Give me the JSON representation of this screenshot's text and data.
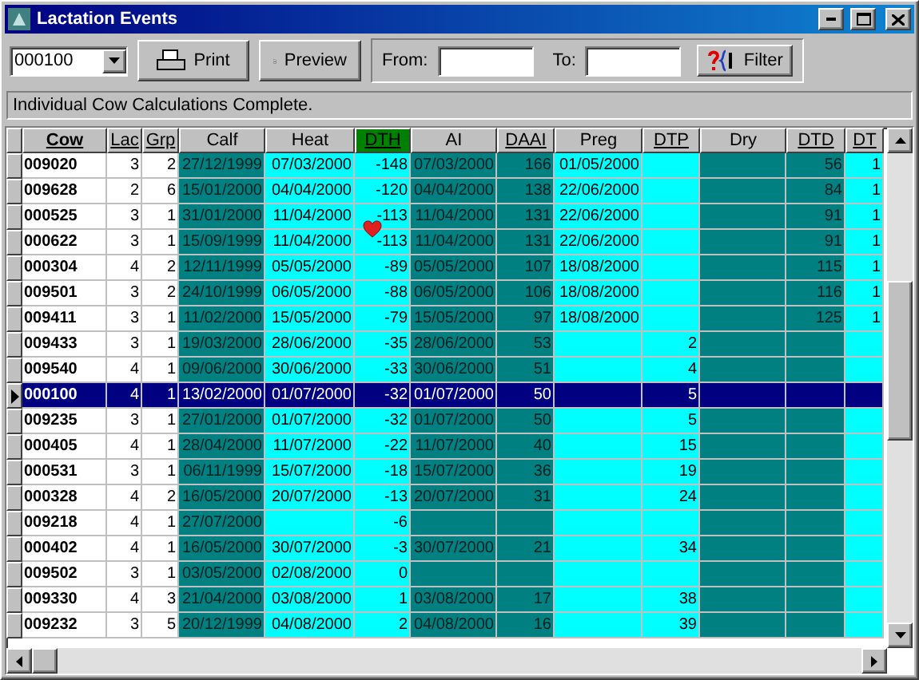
{
  "window": {
    "title": "Lactation Events"
  },
  "toolbar": {
    "cow_select": "000100",
    "print": "Print",
    "preview": "Preview",
    "from_label": "From:",
    "to_label": "To:",
    "filter": "Filter"
  },
  "status": "Individual Cow Calculations Complete.",
  "table": {
    "columns": [
      {
        "label": "Cow",
        "underlined": true,
        "color": "#ffffff",
        "highlighted": false
      },
      {
        "label": "Lac",
        "underlined": true,
        "color": "#ffffff",
        "highlighted": false
      },
      {
        "label": "Grp",
        "underlined": true,
        "color": "#ffffff",
        "highlighted": false
      },
      {
        "label": "Calf",
        "underlined": false,
        "color": "#008080",
        "highlighted": false
      },
      {
        "label": "Heat",
        "underlined": false,
        "color": "#00ffff",
        "highlighted": false
      },
      {
        "label": "DTH",
        "underlined": true,
        "color": "#00ffff",
        "highlighted": true
      },
      {
        "label": "AI",
        "underlined": false,
        "color": "#008080",
        "highlighted": false
      },
      {
        "label": "DAAI",
        "underlined": true,
        "color": "#008080",
        "highlighted": false
      },
      {
        "label": "Preg",
        "underlined": false,
        "color": "#00ffff",
        "highlighted": false
      },
      {
        "label": "DTP",
        "underlined": true,
        "color": "#00ffff",
        "highlighted": false
      },
      {
        "label": "Dry",
        "underlined": false,
        "color": "#008080",
        "highlighted": false
      },
      {
        "label": "DTD",
        "underlined": true,
        "color": "#008080",
        "highlighted": false
      },
      {
        "label": "DT",
        "underlined": true,
        "color": "#00ffff",
        "highlighted": false
      }
    ],
    "rows": [
      {
        "selected": false,
        "cells": [
          "009020",
          "3",
          "2",
          "27/12/1999",
          "07/03/2000",
          "-148",
          "07/03/2000",
          "166",
          "01/05/2000",
          "",
          "",
          "56",
          "1"
        ]
      },
      {
        "selected": false,
        "cells": [
          "009628",
          "2",
          "6",
          "15/01/2000",
          "04/04/2000",
          "-120",
          "04/04/2000",
          "138",
          "22/06/2000",
          "",
          "",
          "84",
          "1"
        ]
      },
      {
        "selected": false,
        "cells": [
          "000525",
          "3",
          "1",
          "31/01/2000",
          "11/04/2000",
          "-113",
          "11/04/2000",
          "131",
          "22/06/2000",
          "",
          "",
          "91",
          "1"
        ]
      },
      {
        "selected": false,
        "cells": [
          "000622",
          "3",
          "1",
          "15/09/1999",
          "11/04/2000",
          "-113",
          "11/04/2000",
          "131",
          "22/06/2000",
          "",
          "",
          "91",
          "1"
        ]
      },
      {
        "selected": false,
        "cells": [
          "000304",
          "4",
          "2",
          "12/11/1999",
          "05/05/2000",
          "-89",
          "05/05/2000",
          "107",
          "18/08/2000",
          "",
          "",
          "115",
          "1"
        ]
      },
      {
        "selected": false,
        "cells": [
          "009501",
          "3",
          "2",
          "24/10/1999",
          "06/05/2000",
          "-88",
          "06/05/2000",
          "106",
          "18/08/2000",
          "",
          "",
          "116",
          "1"
        ]
      },
      {
        "selected": false,
        "cells": [
          "009411",
          "3",
          "1",
          "11/02/2000",
          "15/05/2000",
          "-79",
          "15/05/2000",
          "97",
          "18/08/2000",
          "",
          "",
          "125",
          "1"
        ]
      },
      {
        "selected": false,
        "cells": [
          "009433",
          "3",
          "1",
          "19/03/2000",
          "28/06/2000",
          "-35",
          "28/06/2000",
          "53",
          "",
          "2",
          "",
          "",
          ""
        ]
      },
      {
        "selected": false,
        "cells": [
          "009540",
          "4",
          "1",
          "09/06/2000",
          "30/06/2000",
          "-33",
          "30/06/2000",
          "51",
          "",
          "4",
          "",
          "",
          ""
        ]
      },
      {
        "selected": true,
        "cells": [
          "000100",
          "4",
          "1",
          "13/02/2000",
          "01/07/2000",
          "-32",
          "01/07/2000",
          "50",
          "",
          "5",
          "",
          "",
          ""
        ]
      },
      {
        "selected": false,
        "cells": [
          "009235",
          "3",
          "1",
          "27/01/2000",
          "01/07/2000",
          "-32",
          "01/07/2000",
          "50",
          "",
          "5",
          "",
          "",
          ""
        ]
      },
      {
        "selected": false,
        "cells": [
          "000405",
          "4",
          "1",
          "28/04/2000",
          "11/07/2000",
          "-22",
          "11/07/2000",
          "40",
          "",
          "15",
          "",
          "",
          ""
        ]
      },
      {
        "selected": false,
        "cells": [
          "000531",
          "3",
          "1",
          "06/11/1999",
          "15/07/2000",
          "-18",
          "15/07/2000",
          "36",
          "",
          "19",
          "",
          "",
          ""
        ]
      },
      {
        "selected": false,
        "cells": [
          "000328",
          "4",
          "2",
          "16/05/2000",
          "20/07/2000",
          "-13",
          "20/07/2000",
          "31",
          "",
          "24",
          "",
          "",
          ""
        ]
      },
      {
        "selected": false,
        "cells": [
          "009218",
          "4",
          "1",
          "27/07/2000",
          "",
          "-6",
          "",
          "",
          "",
          "",
          "",
          "",
          ""
        ]
      },
      {
        "selected": false,
        "cells": [
          "000402",
          "4",
          "1",
          "16/05/2000",
          "30/07/2000",
          "-3",
          "30/07/2000",
          "21",
          "",
          "34",
          "",
          "",
          ""
        ]
      },
      {
        "selected": false,
        "cells": [
          "009502",
          "3",
          "1",
          "03/05/2000",
          "02/08/2000",
          "0",
          "",
          "",
          "",
          "",
          "",
          "",
          ""
        ]
      },
      {
        "selected": false,
        "cells": [
          "009330",
          "4",
          "3",
          "21/04/2000",
          "03/08/2000",
          "1",
          "03/08/2000",
          "17",
          "",
          "38",
          "",
          "",
          ""
        ]
      },
      {
        "selected": false,
        "cells": [
          "009232",
          "3",
          "5",
          "20/12/1999",
          "04/08/2000",
          "2",
          "04/08/2000",
          "16",
          "",
          "39",
          "",
          "",
          ""
        ]
      }
    ]
  }
}
